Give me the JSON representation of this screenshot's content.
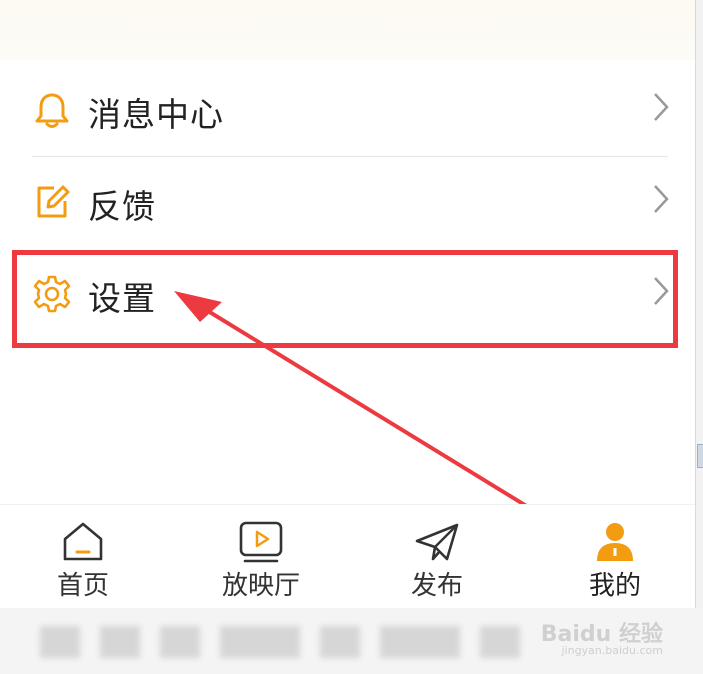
{
  "menu": {
    "items": [
      {
        "label": "消息中心",
        "icon": "bell-icon"
      },
      {
        "label": "反馈",
        "icon": "edit-icon"
      },
      {
        "label": "设置",
        "icon": "gear-icon"
      }
    ]
  },
  "tabbar": {
    "tabs": [
      {
        "label": "首页",
        "icon": "home-icon"
      },
      {
        "label": "放映厅",
        "icon": "play-screen-icon"
      },
      {
        "label": "发布",
        "icon": "send-icon"
      },
      {
        "label": "我的",
        "icon": "user-icon",
        "active": true
      }
    ]
  },
  "watermark": {
    "text": "Baidu 经验",
    "sub": "jingyan.baidu.com"
  },
  "colors": {
    "accent": "#f39c12",
    "highlight": "#ec3a40",
    "text": "#222222",
    "chevron": "#999999"
  }
}
